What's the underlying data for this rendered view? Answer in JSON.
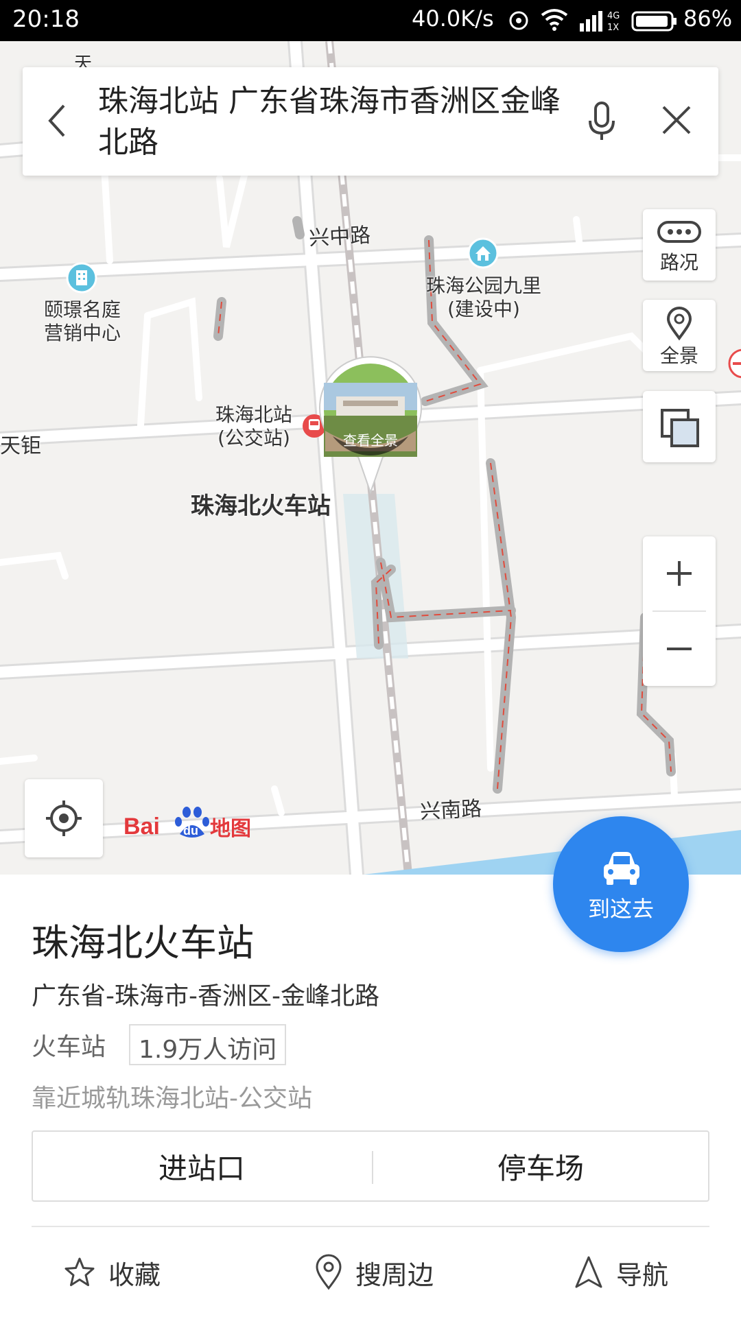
{
  "status_bar": {
    "time": "20:18",
    "net_speed": "40.0K/s",
    "battery": "86%"
  },
  "search": {
    "query": "珠海北站 广东省珠海市香洲区金峰北路"
  },
  "map": {
    "road_labels": [
      "兴中路",
      "兴南路",
      "天钜",
      "天"
    ],
    "pois": [
      {
        "name": "颐璟名庭\n营销中心"
      },
      {
        "name": "珠海公园九里\n(建设中)"
      },
      {
        "name": "珠海北站\n(公交站)"
      }
    ],
    "station_label": "珠海北火车站",
    "panorama_caption": "查看全景",
    "logo": "Bai du 地图",
    "controls": {
      "traffic": "路况",
      "panorama": "全景"
    }
  },
  "go_button": {
    "label": "到这去"
  },
  "place": {
    "name": "珠海北火车站",
    "address": "广东省-珠海市-香洲区-金峰北路",
    "category": "火车站",
    "visits": "1.9万人访问",
    "nearby": "靠近城轨珠海北站-公交站",
    "sub_actions": [
      "进站口",
      "停车场"
    ],
    "actions": [
      "收藏",
      "搜周边",
      "导航"
    ]
  },
  "colors": {
    "accent": "#2e86ee",
    "map_bg": "#f3f2f0",
    "status_bar": "#000000",
    "poi_marker": "#e84b4b",
    "poi_teal": "#5bc0de"
  }
}
